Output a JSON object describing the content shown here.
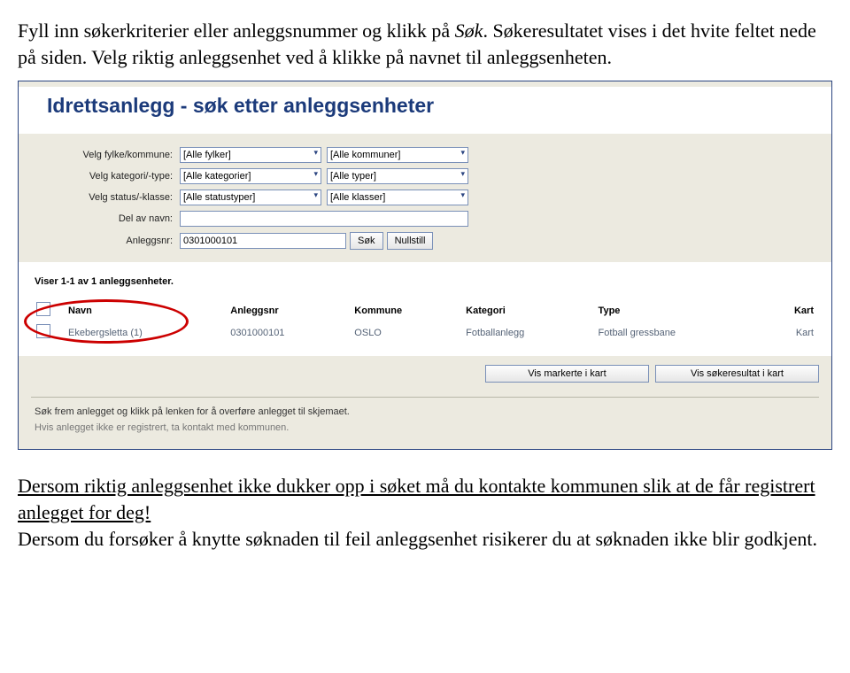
{
  "instr": {
    "part1": "Fyll inn søkerkriterier eller anleggsnummer og klikk på ",
    "search_word": "Søk",
    "part2": ". Søkeresultatet vises i det hvite feltet nede på siden. Velg riktig anleggsenhet ved å klikke på navnet til anleggsenheten."
  },
  "app": {
    "title": "Idrettsanlegg - søk etter anleggsenheter"
  },
  "form": {
    "rows": [
      {
        "label": "Velg fylke/kommune:",
        "sel1": "[Alle fylker]",
        "sel2": "[Alle kommuner]"
      },
      {
        "label": "Velg kategori/-type:",
        "sel1": "[Alle kategorier]",
        "sel2": "[Alle typer]"
      },
      {
        "label": "Velg status/-klasse:",
        "sel1": "[Alle statustyper]",
        "sel2": "[Alle klasser]"
      }
    ],
    "name_label": "Del av navn:",
    "name_value": "",
    "nr_label": "Anleggsnr:",
    "nr_value": "0301000101",
    "search_btn": "Søk",
    "reset_btn": "Nullstill"
  },
  "results": {
    "count_text": "Viser 1-1 av 1 anleggsenheter.",
    "headers": [
      "",
      "Navn",
      "Anleggsnr",
      "Kommune",
      "Kategori",
      "Type",
      "Kart"
    ],
    "row": {
      "navn": "Ekebergsletta (1)",
      "anleggsnr": "0301000101",
      "kommune": "OSLO",
      "kategori": "Fotballanlegg",
      "type": "Fotball gressbane",
      "kart": "Kart"
    },
    "btn_marked": "Vis markerte i kart",
    "btn_result": "Vis søkeresultat i kart"
  },
  "notices": {
    "line1": "Søk frem anlegget og klikk på lenken for å overføre anlegget til skjemaet.",
    "line2": "Hvis anlegget ikke er registrert, ta kontakt med kommunen."
  },
  "post": {
    "underline": "Dersom riktig anleggsenhet ikke dukker opp i søket må du kontakte kommunen slik at de får registrert anlegget for deg!",
    "plain": "Dersom du forsøker å knytte søknaden til feil anleggsenhet risikerer du at søknaden ikke blir godkjent."
  }
}
